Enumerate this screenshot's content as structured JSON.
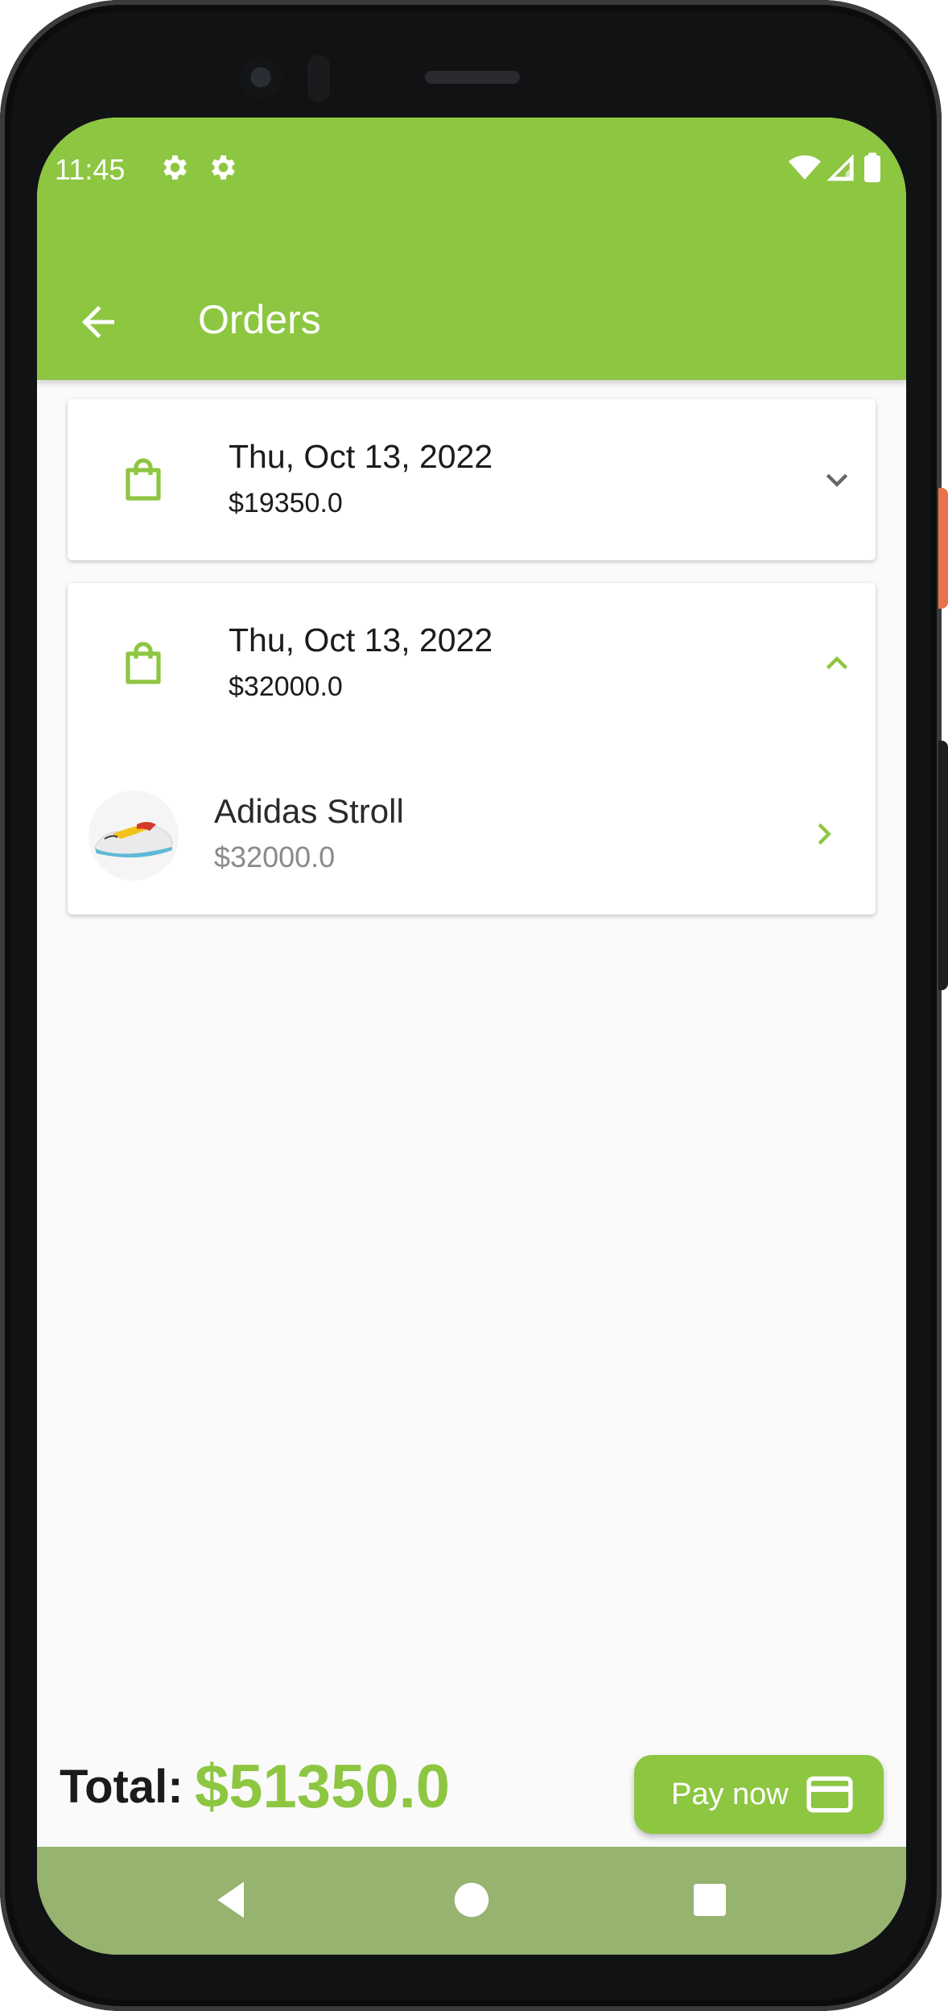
{
  "status_bar": {
    "time": "11:45",
    "left_icons": [
      "settings-gear-icon",
      "settings-gear-icon"
    ],
    "right_icons": [
      "wifi-icon",
      "cell-signal-icon",
      "battery-icon"
    ]
  },
  "app_bar": {
    "title": "Orders",
    "back_icon": "arrow-back-icon"
  },
  "orders": [
    {
      "date": "Thu, Oct 13, 2022",
      "amount": "$19350.0",
      "expanded": false,
      "icon": "shopping-bag-icon"
    },
    {
      "date": "Thu, Oct 13, 2022",
      "amount": "$32000.0",
      "expanded": true,
      "icon": "shopping-bag-icon",
      "items": [
        {
          "name": "Adidas Stroll",
          "price": "$32000.0",
          "image": "sneaker-thumbnail"
        }
      ]
    }
  ],
  "footer": {
    "total_label": "Total:",
    "total_value": "$51350.0",
    "pay_button_label": "Pay now",
    "pay_icon": "credit-card-icon"
  },
  "nav_bar": {
    "buttons": [
      "back-triangle-icon",
      "home-circle-icon",
      "recents-square-icon"
    ]
  },
  "colors": {
    "accent": "#8dc641",
    "nav_bar": "#97b370",
    "background": "#fafafa",
    "muted_text": "#8a8a8a"
  }
}
